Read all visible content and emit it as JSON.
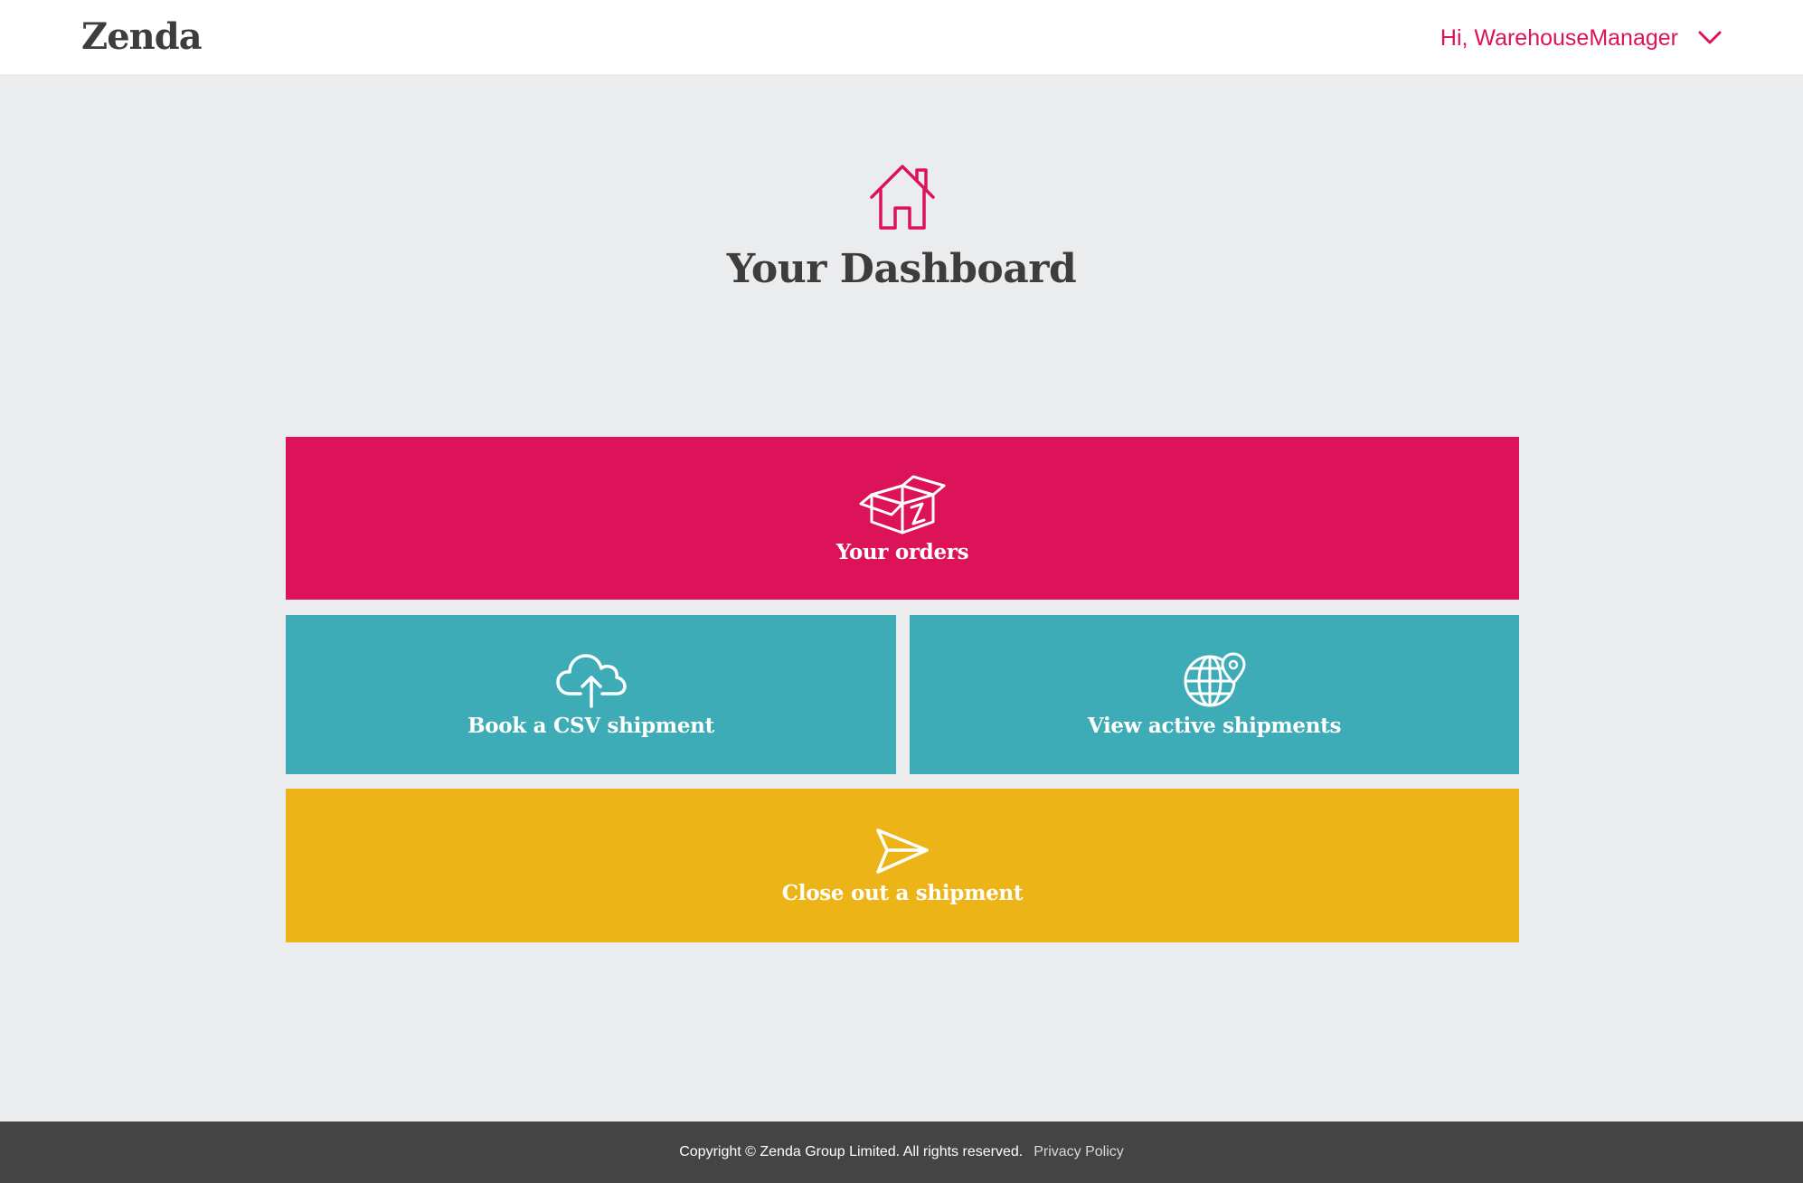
{
  "header": {
    "logo_text": "Zenda",
    "greeting": "Hi, WarehouseManager",
    "menu_icon": "chevron-down-icon"
  },
  "hero": {
    "icon": "house-icon",
    "title": "Your Dashboard"
  },
  "tiles": [
    {
      "id": "your-orders",
      "label": "Your orders",
      "icon": "open-box-icon",
      "color": "#dd1359"
    },
    {
      "id": "book-csv-shipment",
      "label": "Book a CSV shipment",
      "icon": "cloud-upload-icon",
      "color": "#3eacb7"
    },
    {
      "id": "view-active-shipments",
      "label": "View active shipments",
      "icon": "globe-location-icon",
      "color": "#3eacb7"
    },
    {
      "id": "close-out-shipment",
      "label": "Close out a shipment",
      "icon": "paper-plane-icon",
      "color": "#edb417"
    }
  ],
  "footer": {
    "copyright": "Copyright © Zenda Group Limited. All rights reserved.",
    "privacy_link": "Privacy Policy"
  },
  "colors": {
    "brand_pink": "#dd1359",
    "teal": "#3eacb7",
    "yellow": "#edb417",
    "background": "#ebecee",
    "footer": "#444444",
    "text_dark": "#3d3d3d"
  }
}
